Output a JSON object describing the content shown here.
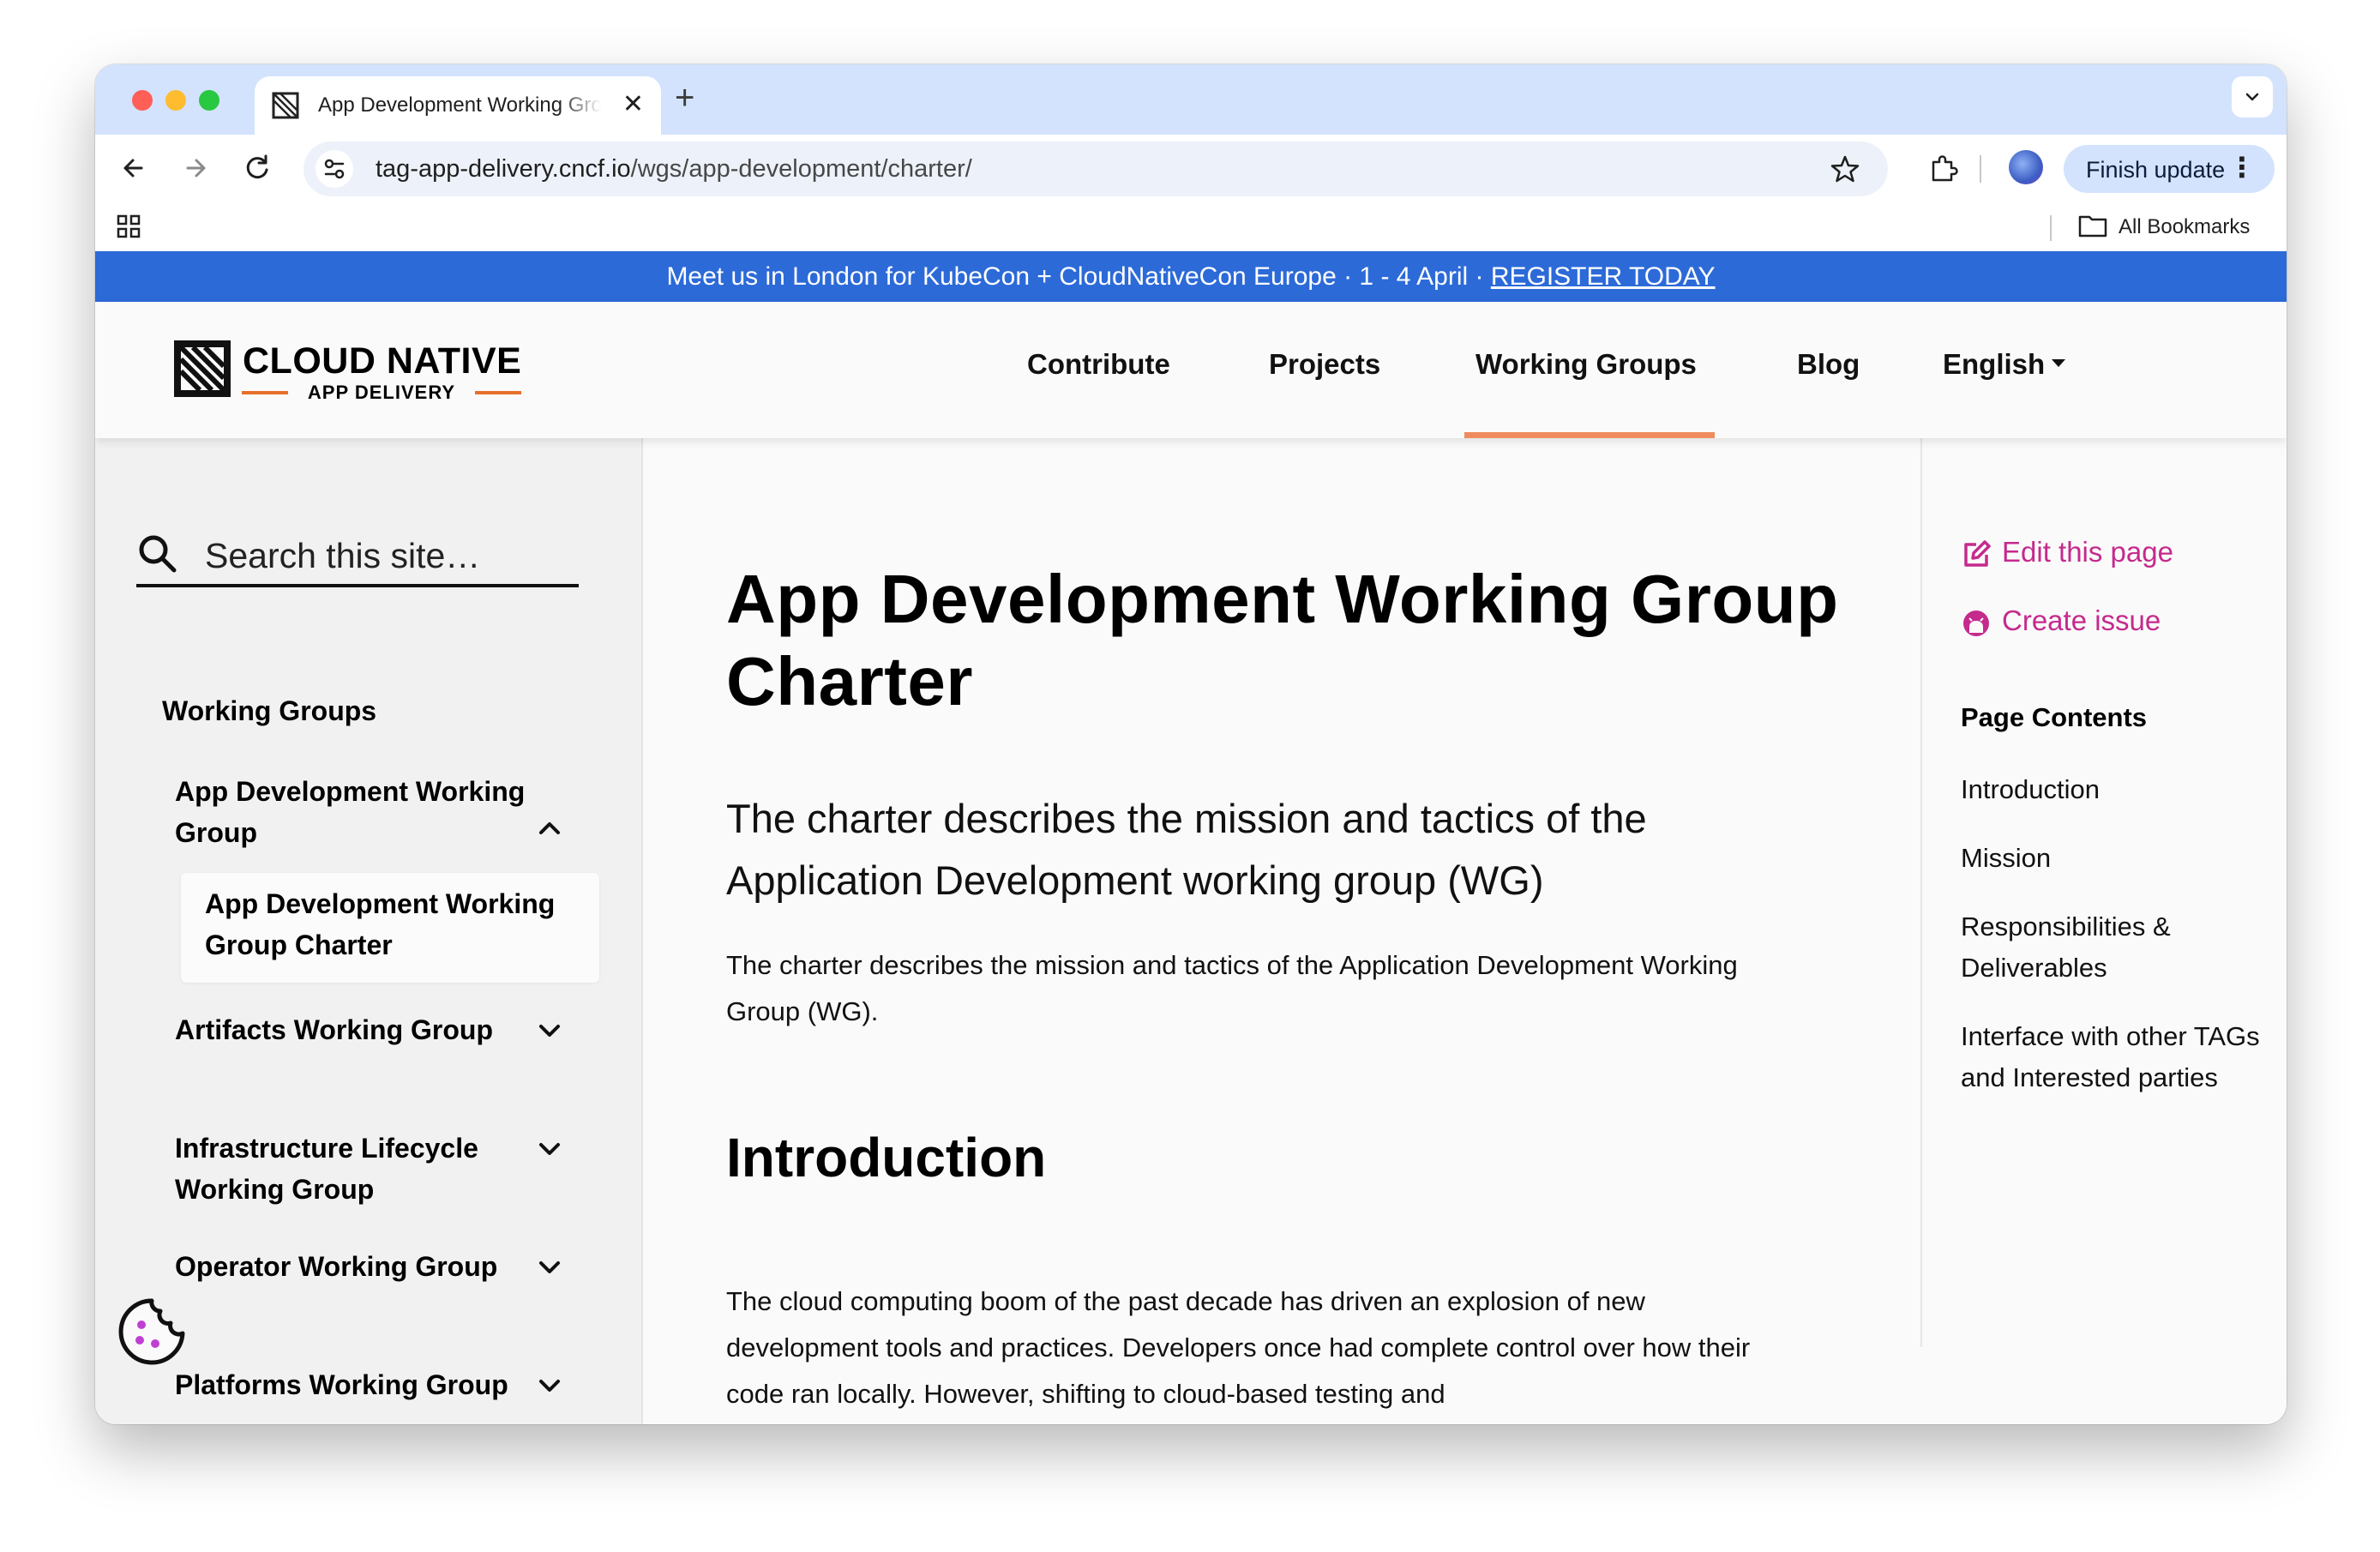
{
  "browser": {
    "tab_title": "App Development Working Group Charter | CNCF TAG App Delivery",
    "tab_close": "✕",
    "new_tab": "+",
    "url_domain": "tag-app-delivery.cncf.io",
    "url_path": "/wgs/app-development/charter/",
    "finish_update_label": "Finish update",
    "all_bookmarks_label": "All Bookmarks"
  },
  "announcement": {
    "text": "Meet us in London for KubeCon + CloudNativeCon Europe · 1 - 4 April · ",
    "link": "REGISTER TODAY"
  },
  "site": {
    "logo_name": "CLOUD NATIVE",
    "logo_sub": "APP DELIVERY",
    "nav": {
      "contribute": "Contribute",
      "projects": "Projects",
      "working_groups": "Working Groups",
      "blog": "Blog",
      "language": "English"
    }
  },
  "sidebar": {
    "search_placeholder": "Search this site…",
    "root": "Working Groups",
    "items": [
      {
        "label": "App Development Working Group",
        "expanded": true
      },
      {
        "label": "Artifacts Working Group",
        "expanded": false
      },
      {
        "label": "Infrastructure Lifecycle Working Group",
        "expanded": false
      },
      {
        "label": "Operator Working Group",
        "expanded": false
      },
      {
        "label": "Platforms Working Group",
        "expanded": false
      }
    ],
    "active_child": "App Development Working Group Charter"
  },
  "content": {
    "title": "App Development Working Group Charter",
    "lead": "The charter describes the mission and tactics of the Application Development working group (WG)",
    "para1": "The charter describes the mission and tactics of the Application Development Working Group (WG).",
    "h2_intro": "Introduction",
    "para2": "The cloud computing boom of the past decade has driven an explosion of new development tools and practices. Developers once had complete control over how their code ran locally. However, shifting to cloud-based testing and"
  },
  "right_sidebar": {
    "edit_page": "Edit this page",
    "create_issue": "Create issue",
    "page_contents_title": "Page Contents",
    "toc": [
      "Introduction",
      "Mission",
      "Responsibilities & Deliverables",
      "Interface with other TAGs and Interested parties"
    ]
  },
  "colors": {
    "accent_pink": "#c52a8d",
    "announce_blue": "#2c6ad8",
    "nav_active_orange": "#ef8c5d",
    "logo_orange": "#e86f2a"
  }
}
